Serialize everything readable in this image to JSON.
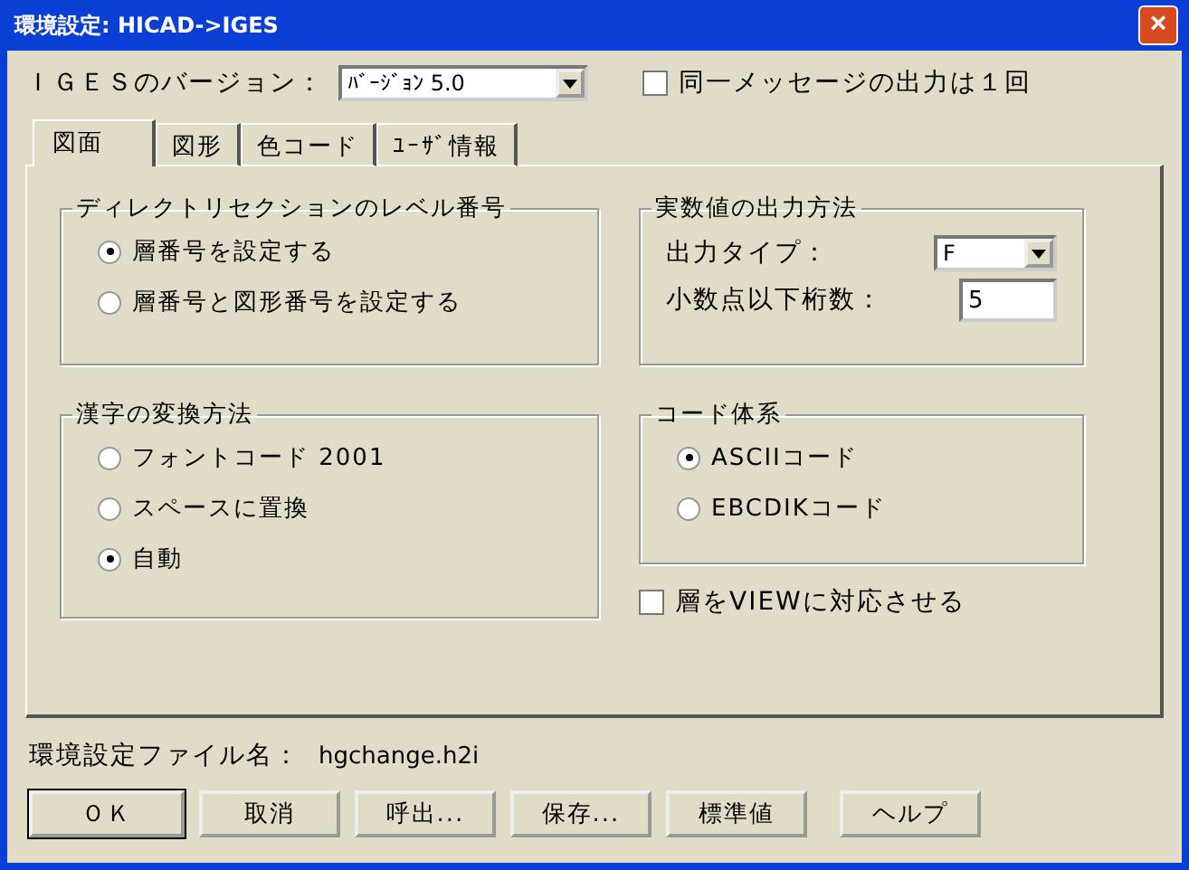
{
  "window": {
    "title": "環境設定: HICAD->IGES",
    "close": "×"
  },
  "version": {
    "label": "ＩＧＥＳのバージョン：",
    "value": "ﾊﾞｰｼﾞｮﾝ 5.0"
  },
  "message_once": {
    "label": "同一メッセージの出力は１回",
    "checked": false
  },
  "tabs": [
    {
      "label": "図面",
      "selected": true
    },
    {
      "label": "図形",
      "selected": false
    },
    {
      "label": "色コード",
      "selected": false
    },
    {
      "label": "ﾕｰｻﾞ情報",
      "selected": false
    }
  ],
  "directory_level": {
    "title": "ディレクトリセクションのレベル番号",
    "options": [
      {
        "label": "層番号を設定する",
        "selected": true
      },
      {
        "label": "層番号と図形番号を設定する",
        "selected": false
      }
    ]
  },
  "kanji_conversion": {
    "title": "漢字の変換方法",
    "options": [
      {
        "label": "フォントコード 2001",
        "selected": false
      },
      {
        "label": "スペースに置換",
        "selected": false
      },
      {
        "label": "自動",
        "selected": true
      }
    ]
  },
  "real_output": {
    "title": "実数値の出力方法",
    "output_type": {
      "label": "出力タイプ：",
      "value": "F"
    },
    "decimals": {
      "label": "小数点以下桁数：",
      "value": "5"
    }
  },
  "code_system": {
    "title": "コード体系",
    "options": [
      {
        "label": "ASCIIコード",
        "selected": true
      },
      {
        "label": "EBCDIKコード",
        "selected": false
      }
    ]
  },
  "layer_view": {
    "label": "層をVIEWに対応させる",
    "checked": false
  },
  "settings_file": {
    "label": "環境設定ファイル名：",
    "value": "hgchange.h2i"
  },
  "buttons": [
    {
      "label": "ＯＫ",
      "default": true
    },
    {
      "label": "取消",
      "default": false
    },
    {
      "label": "呼出...",
      "default": false
    },
    {
      "label": "保存...",
      "default": false
    },
    {
      "label": "標準値",
      "default": false
    },
    {
      "label": "ヘルプ",
      "default": false
    }
  ]
}
